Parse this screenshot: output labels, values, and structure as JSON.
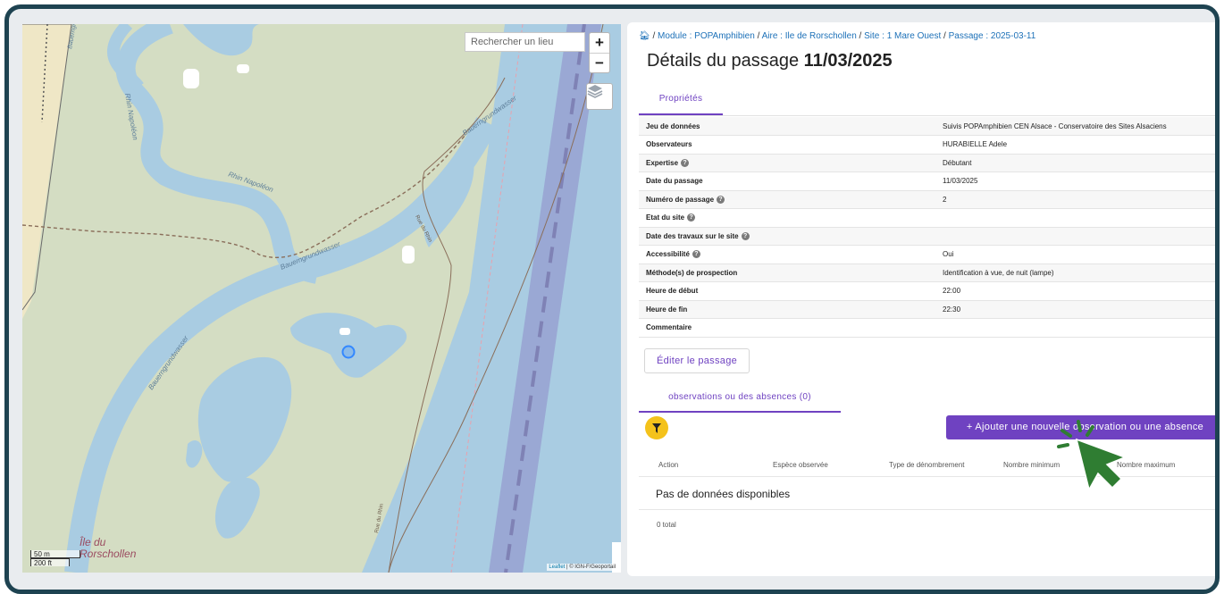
{
  "map": {
    "search_placeholder": "Rechercher un lieu",
    "zoom_in": "+",
    "zoom_out": "−",
    "scale_metric": "50 m",
    "scale_imperial": "200 ft",
    "place_line1": "Île du",
    "place_line2": "Rorschollen",
    "attribution_link": "Leaflet",
    "attribution_text": " | © IGN-F/Geoportail",
    "labels": {
      "rhin1": "Rhin Napoléon",
      "rhin2": "Rhin Napoléon",
      "bauer1": "Bauerngrundwasser",
      "bauer2": "Bauerngrundwasser",
      "bauer3": "Bauerngrundwasser",
      "bauer4": "Bauerngrundwasser",
      "road1": "Rue du Rhin",
      "road2": "Rue du Rhin"
    }
  },
  "breadcrumb": {
    "module": "Module : POPAmphibien",
    "aire": "Aire : Ile de Rorschollen",
    "site": "Site : 1 Mare Ouest",
    "passage": "Passage : 2025-03-11"
  },
  "page_title": {
    "prefix": "Détails du passage ",
    "date": "11/03/2025"
  },
  "tab_properties": "Propriétés",
  "properties": [
    {
      "label": "Jeu de données",
      "value": "Suivis POPAmphibien CEN Alsace - Conservatoire des Sites Alsaciens",
      "help": false
    },
    {
      "label": "Observateurs",
      "value": "HURABIELLE Adele",
      "help": false
    },
    {
      "label": "Expertise",
      "value": "Débutant",
      "help": true
    },
    {
      "label": "Date du passage",
      "value": "11/03/2025",
      "help": false
    },
    {
      "label": "Numéro de passage",
      "value": "2",
      "help": true
    },
    {
      "label": "Etat du site",
      "value": "",
      "help": true
    },
    {
      "label": "Date des travaux sur le site",
      "value": "",
      "help": true
    },
    {
      "label": "Accessibilité",
      "value": "Oui",
      "help": true
    },
    {
      "label": "Méthode(s) de prospection",
      "value": "Identification à vue, de nuit (lampe)",
      "help": false
    },
    {
      "label": "Heure de début",
      "value": "22:00",
      "help": false
    },
    {
      "label": "Heure de fin",
      "value": "22:30",
      "help": false
    },
    {
      "label": "Commentaire",
      "value": "",
      "help": false
    }
  ],
  "edit_button": "Éditer le passage",
  "obs_tab": "observations ou des absences (0)",
  "add_button": "+ Ajouter une nouvelle observation ou une absence",
  "table": {
    "columns": [
      "Action",
      "Espèce observée",
      "Type de dénombrement",
      "Nombre minimum",
      "Nombre maximum"
    ],
    "empty": "Pas de données disponibles",
    "total": "0 total"
  },
  "colors": {
    "accent": "#6f42c1",
    "filter": "#f4c21b",
    "link": "#1d71b8",
    "frame": "#1e4351",
    "cursor": "#2f7d32"
  }
}
